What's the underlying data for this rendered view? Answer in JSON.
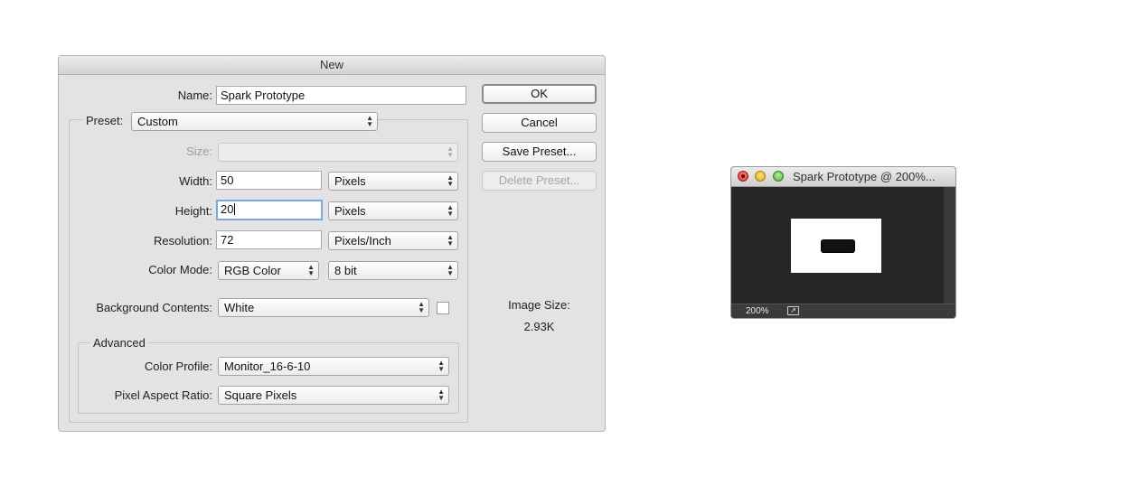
{
  "dialog": {
    "title": "New",
    "name_label": "Name:",
    "name_value": "Spark Prototype",
    "preset_label": "Preset:",
    "preset_value": "Custom",
    "size_label": "Size:",
    "size_value": "",
    "width_label": "Width:",
    "width_value": "50",
    "width_unit": "Pixels",
    "height_label": "Height:",
    "height_value": "20",
    "height_unit": "Pixels",
    "resolution_label": "Resolution:",
    "resolution_value": "72",
    "resolution_unit": "Pixels/Inch",
    "color_mode_label": "Color Mode:",
    "color_mode_value": "RGB Color",
    "bit_depth_value": "8 bit",
    "background_label": "Background Contents:",
    "background_value": "White",
    "advanced_label": "Advanced",
    "color_profile_label": "Color Profile:",
    "color_profile_value": "Monitor_16-6-10",
    "pixel_aspect_label": "Pixel Aspect Ratio:",
    "pixel_aspect_value": "Square Pixels",
    "buttons": {
      "ok": "OK",
      "cancel": "Cancel",
      "save_preset": "Save Preset...",
      "delete_preset": "Delete Preset..."
    },
    "image_size_label": "Image Size:",
    "image_size_value": "2.93K"
  },
  "document_window": {
    "title": "Spark Prototype @ 200%...",
    "zoom": "200%",
    "colors": {
      "canvas_bg": "#262626",
      "image_bg": "#ffffff"
    },
    "icons": [
      "close-button-icon",
      "minimize-button-icon",
      "zoom-button-icon",
      "export-icon",
      "resize-grip-icon"
    ]
  }
}
